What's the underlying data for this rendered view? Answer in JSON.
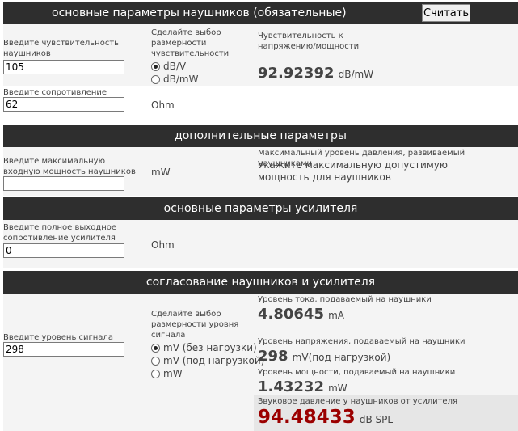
{
  "sections": {
    "main": "основные параметры наушников (обязательные)",
    "extra": "дополнительные параметры",
    "amp": "основные параметры усилителя",
    "match": "согласование наушников и усилителя"
  },
  "calc_button": "Считать",
  "sensitivity": {
    "label": "Введите чувствительность наушников",
    "value": "105",
    "unit_choice_label": "Сделайте выбор размерности чувствительности",
    "options": [
      "dB/V",
      "dB/mW"
    ],
    "result_label": "Чувствительность к напряжению/мощности",
    "result_value": "92.92392",
    "result_unit": "dB/mW"
  },
  "impedance": {
    "label": "Введите сопротивление наушников",
    "value": "62",
    "unit": "Ohm"
  },
  "power": {
    "label": "Введите максимальную входную мощность наушников",
    "value": "",
    "unit": "mW",
    "result_label": "Максимальный уровень давления, развиваемый наушниками",
    "result_text": "Укажите максимальную допустимую мощность для наушников"
  },
  "amp_impedance": {
    "label": "Введите полное выходное сопротивление усилителя",
    "value": "0",
    "unit": "Ohm"
  },
  "signal": {
    "label": "Введите уровень сигнала",
    "value": "298",
    "unit_choice_label": "Сделайте выбор размерности уровня сигнала",
    "options": [
      "mV (без нагрузки)",
      "mV (под нагрузкой)",
      "mW"
    ]
  },
  "results": {
    "current_label": "Уровень тока, подаваемый на наушники",
    "current_value": "4.80645",
    "current_unit": "mA",
    "voltage_label": "Уровень напряжения, подаваемый на наушники",
    "voltage_value": "298",
    "voltage_unit": "mV(под нагрузкой)",
    "power_label": "Уровень мощности, подаваемый на наушники",
    "power_value": "1.43232",
    "power_unit": "mW",
    "spl_label": "Звуковое давление у наушников от усилителя",
    "spl_value": "94.48433",
    "spl_unit": "dB SPL"
  },
  "colors": {
    "header": "#2e2e2e",
    "row": "#f4f4f4",
    "spl": "#9b0000"
  }
}
